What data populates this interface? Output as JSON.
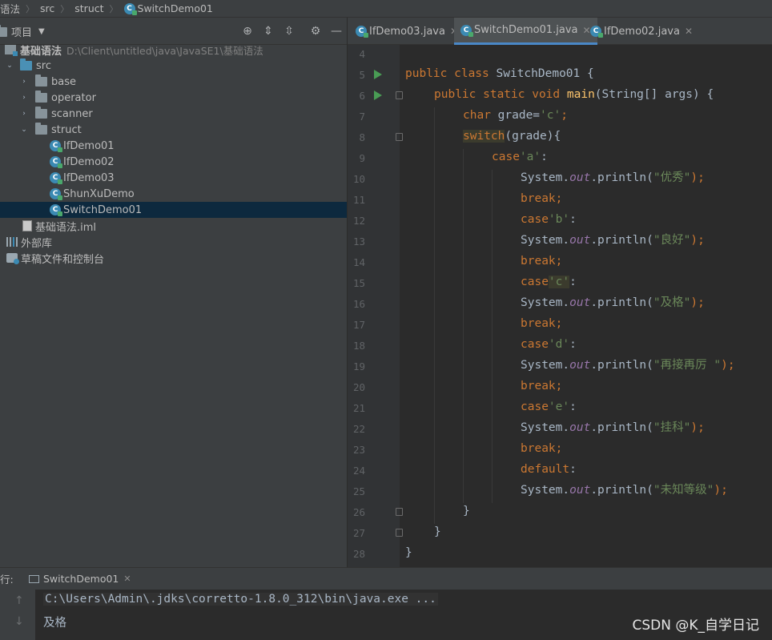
{
  "breadcrumb": [
    "语法",
    "src",
    "struct",
    "SwitchDemo01"
  ],
  "project": {
    "title": "项目",
    "root_name": "基础语法",
    "root_path": "D:\\Client\\untitled\\java\\JavaSE1\\基础语法",
    "tree": {
      "src": "src",
      "base": "base",
      "operator": "operator",
      "scanner": "scanner",
      "struct": "struct",
      "files": [
        "IfDemo01",
        "IfDemo02",
        "IfDemo03",
        "ShunXuDemo",
        "SwitchDemo01"
      ],
      "iml": "基础语法.iml",
      "external": "外部库",
      "scratches": "草稿文件和控制台"
    }
  },
  "tabs": [
    {
      "label": "IfDemo03.java",
      "active": false
    },
    {
      "label": "SwitchDemo01.java",
      "active": true
    },
    {
      "label": "IfDemo02.java",
      "active": false
    }
  ],
  "editor": {
    "line_numbers": [
      "4",
      "5",
      "6",
      "7",
      "8",
      "9",
      "10",
      "11",
      "12",
      "13",
      "14",
      "15",
      "16",
      "17",
      "18",
      "19",
      "20",
      "21",
      "22",
      "23",
      "24",
      "25",
      "26",
      "27",
      "28"
    ],
    "lines": {
      "l5": {
        "k1": "public class ",
        "t": "SwitchDemo01 {"
      },
      "l6": {
        "k1": "public static void ",
        "fn": "main",
        "t": "(String[] args) {"
      },
      "l7": {
        "k1": "char ",
        "t": "grade=",
        "s": "'c'",
        "e": ";"
      },
      "l8": {
        "k1": "switch",
        "t": "(grade){"
      },
      "l9": {
        "k1": "case",
        "s": "'a'",
        "t": ":"
      },
      "l10": {
        "a": "System.",
        "f": "out",
        "b": ".println(",
        "s": "\"优秀\"",
        "e": ");"
      },
      "l11": {
        "k1": "break",
        "e": ";"
      },
      "l12": {
        "k1": "case",
        "s": "'b'",
        "t": ":"
      },
      "l13": {
        "a": "System.",
        "f": "out",
        "b": ".println(",
        "s": "\"良好\"",
        "e": ");"
      },
      "l14": {
        "k1": "break",
        "e": ";"
      },
      "l15": {
        "k1": "case",
        "s": "'c'",
        "t": ":"
      },
      "l16": {
        "a": "System.",
        "f": "out",
        "b": ".println(",
        "s": "\"及格\"",
        "e": ");"
      },
      "l17": {
        "k1": "break",
        "e": ";"
      },
      "l18": {
        "k1": "case",
        "s": "'d'",
        "t": ":"
      },
      "l19": {
        "a": "System.",
        "f": "out",
        "b": ".println(",
        "s": "\"再接再厉 \"",
        "e": ");"
      },
      "l20": {
        "k1": "break",
        "e": ";"
      },
      "l21": {
        "k1": "case",
        "s": "'e'",
        "t": ":"
      },
      "l22": {
        "a": "System.",
        "f": "out",
        "b": ".println(",
        "s": "\"挂科\"",
        "e": ");"
      },
      "l23": {
        "k1": "break",
        "e": ";"
      },
      "l24": {
        "k1": "default",
        "t": ":"
      },
      "l25": {
        "a": "System.",
        "f": "out",
        "b": ".println(",
        "s": "\"未知等级\"",
        "e": ");"
      },
      "l26": {
        "t": "}"
      },
      "l27": {
        "t": "}"
      },
      "l28": {
        "t": "}"
      }
    }
  },
  "run": {
    "label": "行:",
    "tab": "SwitchDemo01",
    "command": "C:\\Users\\Admin\\.jdks\\corretto-1.8.0_312\\bin\\java.exe ...",
    "output": "及格"
  },
  "watermark": "CSDN @K_自学日记"
}
